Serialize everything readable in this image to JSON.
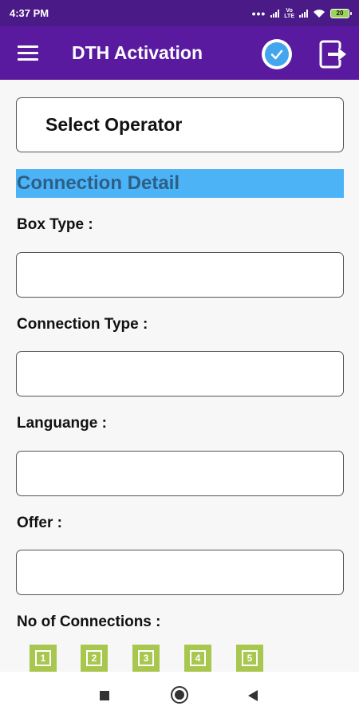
{
  "status_bar": {
    "time": "4:37 PM",
    "network_label": "LTE",
    "battery_level": "20"
  },
  "app_bar": {
    "title": "DTH Activation",
    "icons": [
      "menu-icon",
      "check-circle-icon",
      "exit-icon"
    ]
  },
  "operator_select": {
    "label": "Select Operator"
  },
  "section": {
    "title": "Connection Detail"
  },
  "fields": [
    {
      "label": "Box Type :",
      "value": ""
    },
    {
      "label": "Connection Type :",
      "value": ""
    },
    {
      "label": "Languange :",
      "value": ""
    },
    {
      "label": "Offer :",
      "value": ""
    }
  ],
  "connections": {
    "label": "No of Connections :",
    "options": [
      "1",
      "2",
      "3",
      "4",
      "5"
    ]
  },
  "colors": {
    "status_bar": "#4a1a86",
    "app_bar": "#5a1aa0",
    "section_header": "#4db3f7",
    "connection_button": "#a8c74f"
  },
  "nav_bar": {
    "icons": [
      "recent-apps-icon",
      "home-icon",
      "back-icon"
    ]
  }
}
